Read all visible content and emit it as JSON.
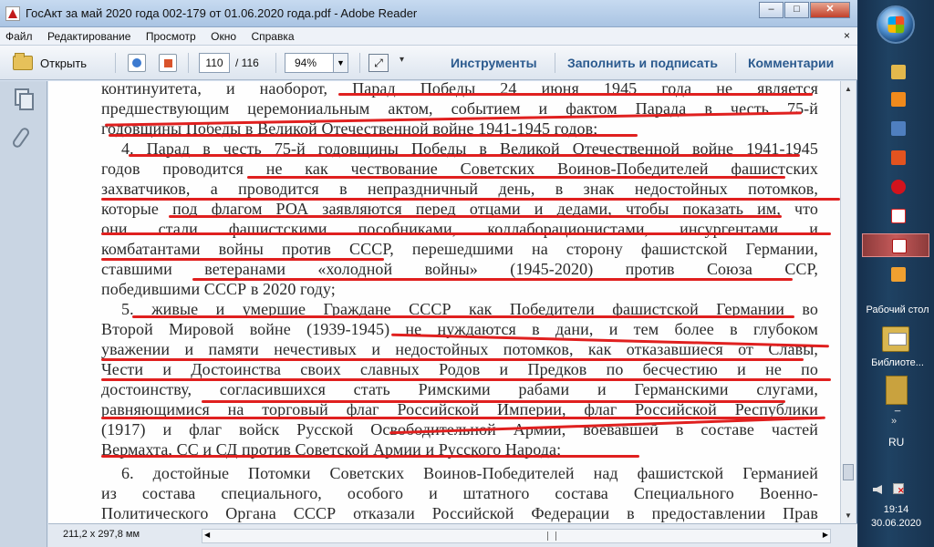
{
  "window": {
    "title": "ГосАкт за май 2020 года 002-179 от 01.06.2020 года.pdf - Adobe Reader",
    "minimize": "–",
    "maximize": "□",
    "close": "✕"
  },
  "menu": {
    "items": [
      "Файл",
      "Редактирование",
      "Просмотр",
      "Окно",
      "Справка"
    ],
    "close": "×"
  },
  "toolbar": {
    "open_label": "Открыть",
    "page_current": "110",
    "page_total": "/ 116",
    "zoom": "94%",
    "tools_label": "Инструменты",
    "fill_sign_label": "Заполнить и подписать",
    "comments_label": "Комментарии",
    "more": "▾"
  },
  "document": {
    "lines": [
      "континуитета, и наоборот, Парад Победы 24 июня 1945 года не является",
      "предшествующим церемониальным актом, событием и фактом Парада в честь 75-й",
      "годовщины Победы в Великой Отечественной войне 1941-1945 годов;",
      "4. Парад в честь 75-й годовщины Победы в Великой Отечественной войне 1941-1945",
      "годов проводится не как чествование Советских Воинов-Победителей фашистских",
      "захватчиков, а проводится в непраздничный день, в знак недостойных потомков,",
      "которые под флагом РОА заявляются перед отцами и дедами, чтобы показать им, что",
      "они стали фашистскими пособниками, коллаборационистами, инсургентами и",
      "комбатантами войны против СССР, перешедшими на сторону фашистской Германии,",
      "ставшими ветеранами «холодной войны» (1945-2020) против Союза ССР,",
      "победившими СССР в 2020 году;",
      "5. живые и умершие Граждане СССР как Победители фашистской Германии во",
      "Второй Мировой войне (1939-1945) не нуждаются в дани, и тем более в глубоком",
      "уважении и памяти нечестивых и недостойных потомков, как отказавшиеся от Славы,",
      "Чести и Достоинства своих славных Родов и Предков по бесчестию и не по",
      "достоинству, согласившихся стать Римскими рабами и Германскими слугами,",
      "равняющимися на торговый флаг Российской Империи, флаг Российской Республики",
      "(1917) и флаг войск Русской Освободительной Армии, воевавшей в составе частей",
      "Вермахта, СС и СД против Советской Армии и Русского Народа;",
      "6. достойные Потомки Советских Воинов-Победителей над фашистской Германией",
      "из состава специального, особого и штатного состава Специального Военно-",
      "Политического Органа СССР отказали Российской Федерации в предоставлении Прав"
    ]
  },
  "status": {
    "page_size": "211,2 x 297,8 мм"
  },
  "taskbar": {
    "desktop_label": "Рабочий стол",
    "library_label": "Библиоте...",
    "folder_label": "_",
    "chevron": "»",
    "lang": "RU",
    "time": "19:14",
    "date": "30.06.2020"
  },
  "colors": {
    "annotation_red": "#e0201f",
    "link_blue": "#2b5a8e",
    "taskbar_active": "#c55a5a"
  }
}
